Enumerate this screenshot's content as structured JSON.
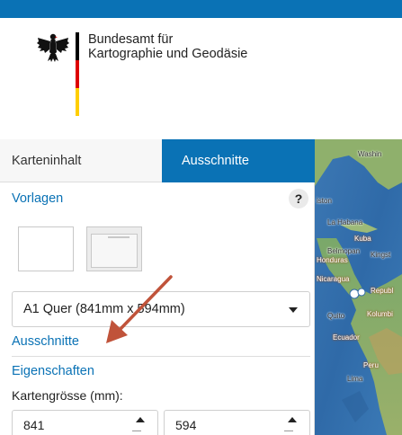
{
  "header": {
    "org_line1": "Bundesamt für",
    "org_line2": "Kartographie und Geodäsie",
    "brand_color": "#0a72b5",
    "flag_colors": [
      "#000000",
      "#dd0000",
      "#ffce00"
    ]
  },
  "tabs": [
    {
      "label": "Karteninhalt",
      "active": false
    },
    {
      "label": "Ausschnitte",
      "active": true
    }
  ],
  "sections": {
    "vorlagen": "Vorlagen",
    "help_label": "?",
    "ausschnitte": "Ausschnitte",
    "eigenschaften": "Eigenschaften",
    "kartengroesse_label": "Kartengrösse (mm):"
  },
  "templates": [
    {
      "name": "blank-template"
    },
    {
      "name": "framed-template"
    }
  ],
  "paper_select": {
    "value": "A1 Quer (841mm x 594mm)"
  },
  "size": {
    "width": "841",
    "height": "594"
  },
  "map": {
    "labels": [
      {
        "text": "Washin",
        "style": "dark"
      },
      {
        "text": "iston",
        "style": "dark"
      },
      {
        "text": "La Habana",
        "style": "dark"
      },
      {
        "text": "Kuba",
        "style": "light"
      },
      {
        "text": "Belmopan",
        "style": "dark"
      },
      {
        "text": "Kingst",
        "style": "dark"
      },
      {
        "text": "Honduras",
        "style": "light"
      },
      {
        "text": "Nicaragua",
        "style": "light"
      },
      {
        "text": "Republ",
        "style": "light"
      },
      {
        "text": "Kolumbi",
        "style": "light"
      },
      {
        "text": "Quito",
        "style": "dark"
      },
      {
        "text": "Ecuador",
        "style": "light"
      },
      {
        "text": "Peru",
        "style": "light"
      },
      {
        "text": "Lima",
        "style": "dark"
      }
    ]
  }
}
